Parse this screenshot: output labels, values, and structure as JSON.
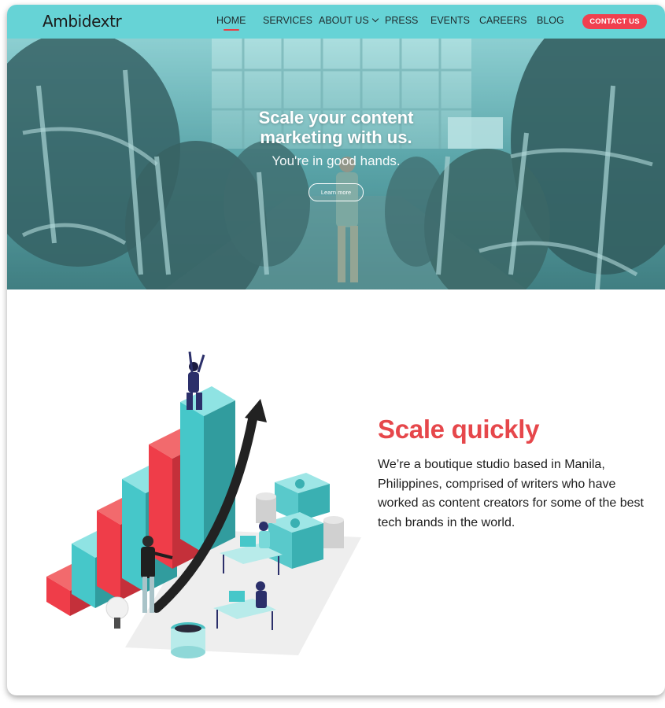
{
  "brand": {
    "logo_text": "Ambidextr"
  },
  "nav": {
    "items": [
      {
        "label": "HOME",
        "active": true
      },
      {
        "label": "SERVICES"
      },
      {
        "label": "ABOUT US"
      },
      {
        "label": "PRESS"
      },
      {
        "label": "EVENTS"
      },
      {
        "label": "CAREERS"
      },
      {
        "label": "BLOG"
      }
    ],
    "cta_label": "CONTACT US"
  },
  "hero": {
    "title_line1": "Scale your content",
    "title_line2": "marketing with us.",
    "subtitle": "You're in good hands.",
    "button_label": "Learn more"
  },
  "feature": {
    "title": "Scale quickly",
    "body": "We’re a boutique studio based in Manila, Philippines, comprised of writers who have worked as content creators for some of the best tech brands in the world."
  },
  "colors": {
    "nav_bg": "#66d3d6",
    "accent_red": "#e6474b",
    "cta_red": "#f0404f",
    "teal": "#46c7c9"
  },
  "icons": {
    "dropdown": "chevron-down-icon"
  }
}
